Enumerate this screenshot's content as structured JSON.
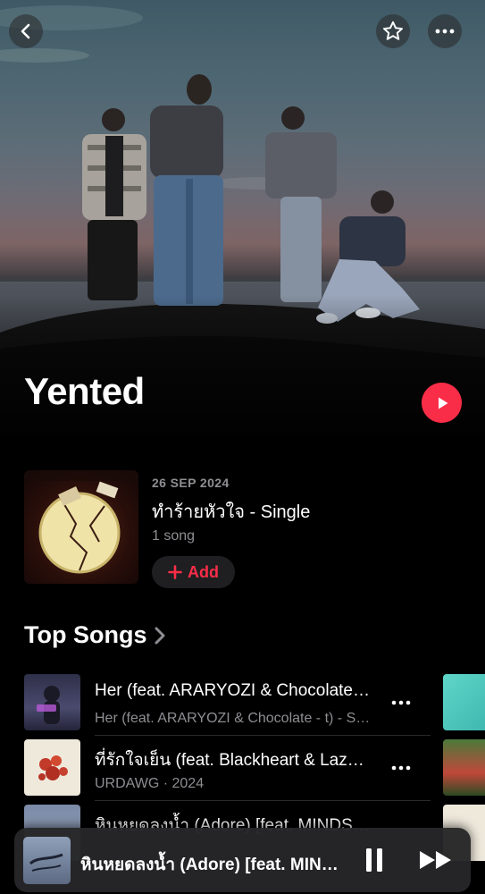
{
  "artist": {
    "name": "Yented"
  },
  "header": {
    "back_icon": "chevron-left-icon",
    "favorite_icon": "star-icon",
    "more_icon": "ellipsis-icon"
  },
  "latest_release": {
    "date": "26 SEP 2024",
    "title": "ทำร้ายหัวใจ - Single",
    "song_count": "1 song",
    "add_label": "Add"
  },
  "top_songs": {
    "title": "Top Songs",
    "items": [
      {
        "title": "Her (feat. ARARYOZI & Chocolate - t)",
        "subtitle": "Her (feat. ARARYOZI & Chocolate - t) - Single"
      },
      {
        "title": "ที่รักใจเย็น (feat. Blackheart & Lazyloxy)",
        "subtitle": "URDAWG · 2024"
      },
      {
        "title": "หินหยดลงน้ำ (Adore) [feat. MINDSET]",
        "subtitle": ""
      }
    ]
  },
  "now_playing": {
    "title": "หินหยดลงน้ำ (Adore) [feat. MINDSET]"
  },
  "colors": {
    "accent": "#fa2d48",
    "secondary_text": "#8e8e93",
    "background": "#000000"
  }
}
